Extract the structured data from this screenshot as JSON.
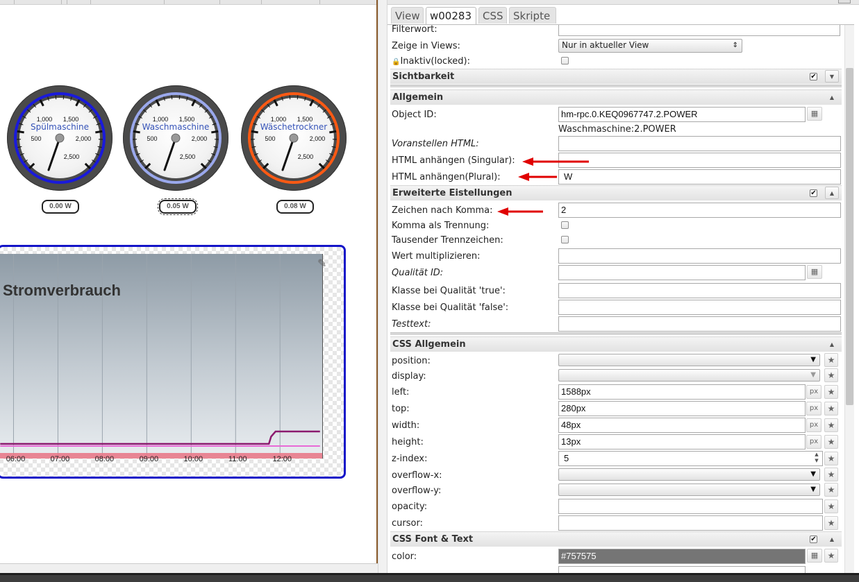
{
  "gauges": [
    {
      "name": "Spülmaschine",
      "readout": "0.00 W",
      "ring_color": "#1a1adb"
    },
    {
      "name": "Waschmaschine",
      "readout": "0.05 W",
      "ring_color": "#9aa8ec"
    },
    {
      "name": "Wäschetrockner",
      "readout": "0.08 W",
      "ring_color": "#ff5a14"
    }
  ],
  "gauge_ticks": {
    "t500": "500",
    "t1000": "1,000",
    "t1500": "1,500",
    "t2000": "2,000",
    "t2500": "2,500"
  },
  "chart_data": {
    "type": "line",
    "title": "Stromverbrauch",
    "x_tick_labels": [
      "06:00",
      "07:00",
      "08:00",
      "09:00",
      "10:00",
      "11:00",
      "12:00"
    ],
    "series": [
      {
        "color": "#8b1a6e",
        "values_description_points": [
          [
            5.7,
            3
          ],
          [
            11.75,
            3
          ],
          [
            11.8,
            13
          ],
          [
            11.9,
            20
          ],
          [
            12.9,
            20
          ]
        ]
      },
      {
        "color": "#e86ad6",
        "values_description_points": [
          [
            5.7,
            0
          ],
          [
            12.9,
            0
          ]
        ]
      }
    ]
  },
  "panel": {
    "tabs": [
      {
        "label": "View"
      },
      {
        "label": "w00283"
      },
      {
        "label": "CSS"
      },
      {
        "label": "Skripte"
      }
    ],
    "filterwort_label": "Filterwort:",
    "zeige_label": "Zeige in Views:",
    "zeige_value": "Nur in aktueller View",
    "inaktiv_label": "Inaktiv(locked):",
    "sections": {
      "sichtbarkeit": "Sichtbarkeit",
      "allgemein": "Allgemein",
      "erweiterte": "Erweiterte Eistellungen",
      "css_allgemein": "CSS Allgemein",
      "css_font": "CSS Font & Text"
    },
    "object_id_label": "Object ID:",
    "object_id_value": "hm-rpc.0.KEQ0967747.2.POWER",
    "object_id_name": "Waschmaschine:2.POWER",
    "voranstellen_label": "Voranstellen HTML:",
    "html_singular_label": "HTML anhängen (Singular):",
    "html_plural_label": "HTML anhängen(Plural):",
    "html_plural_value": "W",
    "zeichen_label": "Zeichen nach Komma:",
    "zeichen_value": "2",
    "komma_label": "Komma als Trennung:",
    "tausender_label": "Tausender Trennzeichen:",
    "wert_label": "Wert multiplizieren:",
    "qualitaet_label": "Qualität ID:",
    "klasse_true_label": "Klasse bei Qualität 'true':",
    "klasse_false_label": "Klasse bei Qualität 'false':",
    "testtext_label": "Testtext:",
    "css": {
      "position_label": "position:",
      "display_label": "display:",
      "left_label": "left:",
      "left_value": "1588px",
      "top_label": "top:",
      "top_value": "280px",
      "width_label": "width:",
      "width_value": "48px",
      "height_label": "height:",
      "height_value": "13px",
      "zindex_label": "z-index:",
      "zindex_value": "5",
      "overflow_x_label": "overflow-x:",
      "overflow_y_label": "overflow-y:",
      "opacity_label": "opacity:",
      "cursor_label": "cursor:",
      "color_label": "color:",
      "color_value": "#757575"
    },
    "px_unit": "px"
  },
  "annotation_color": "#e00000"
}
